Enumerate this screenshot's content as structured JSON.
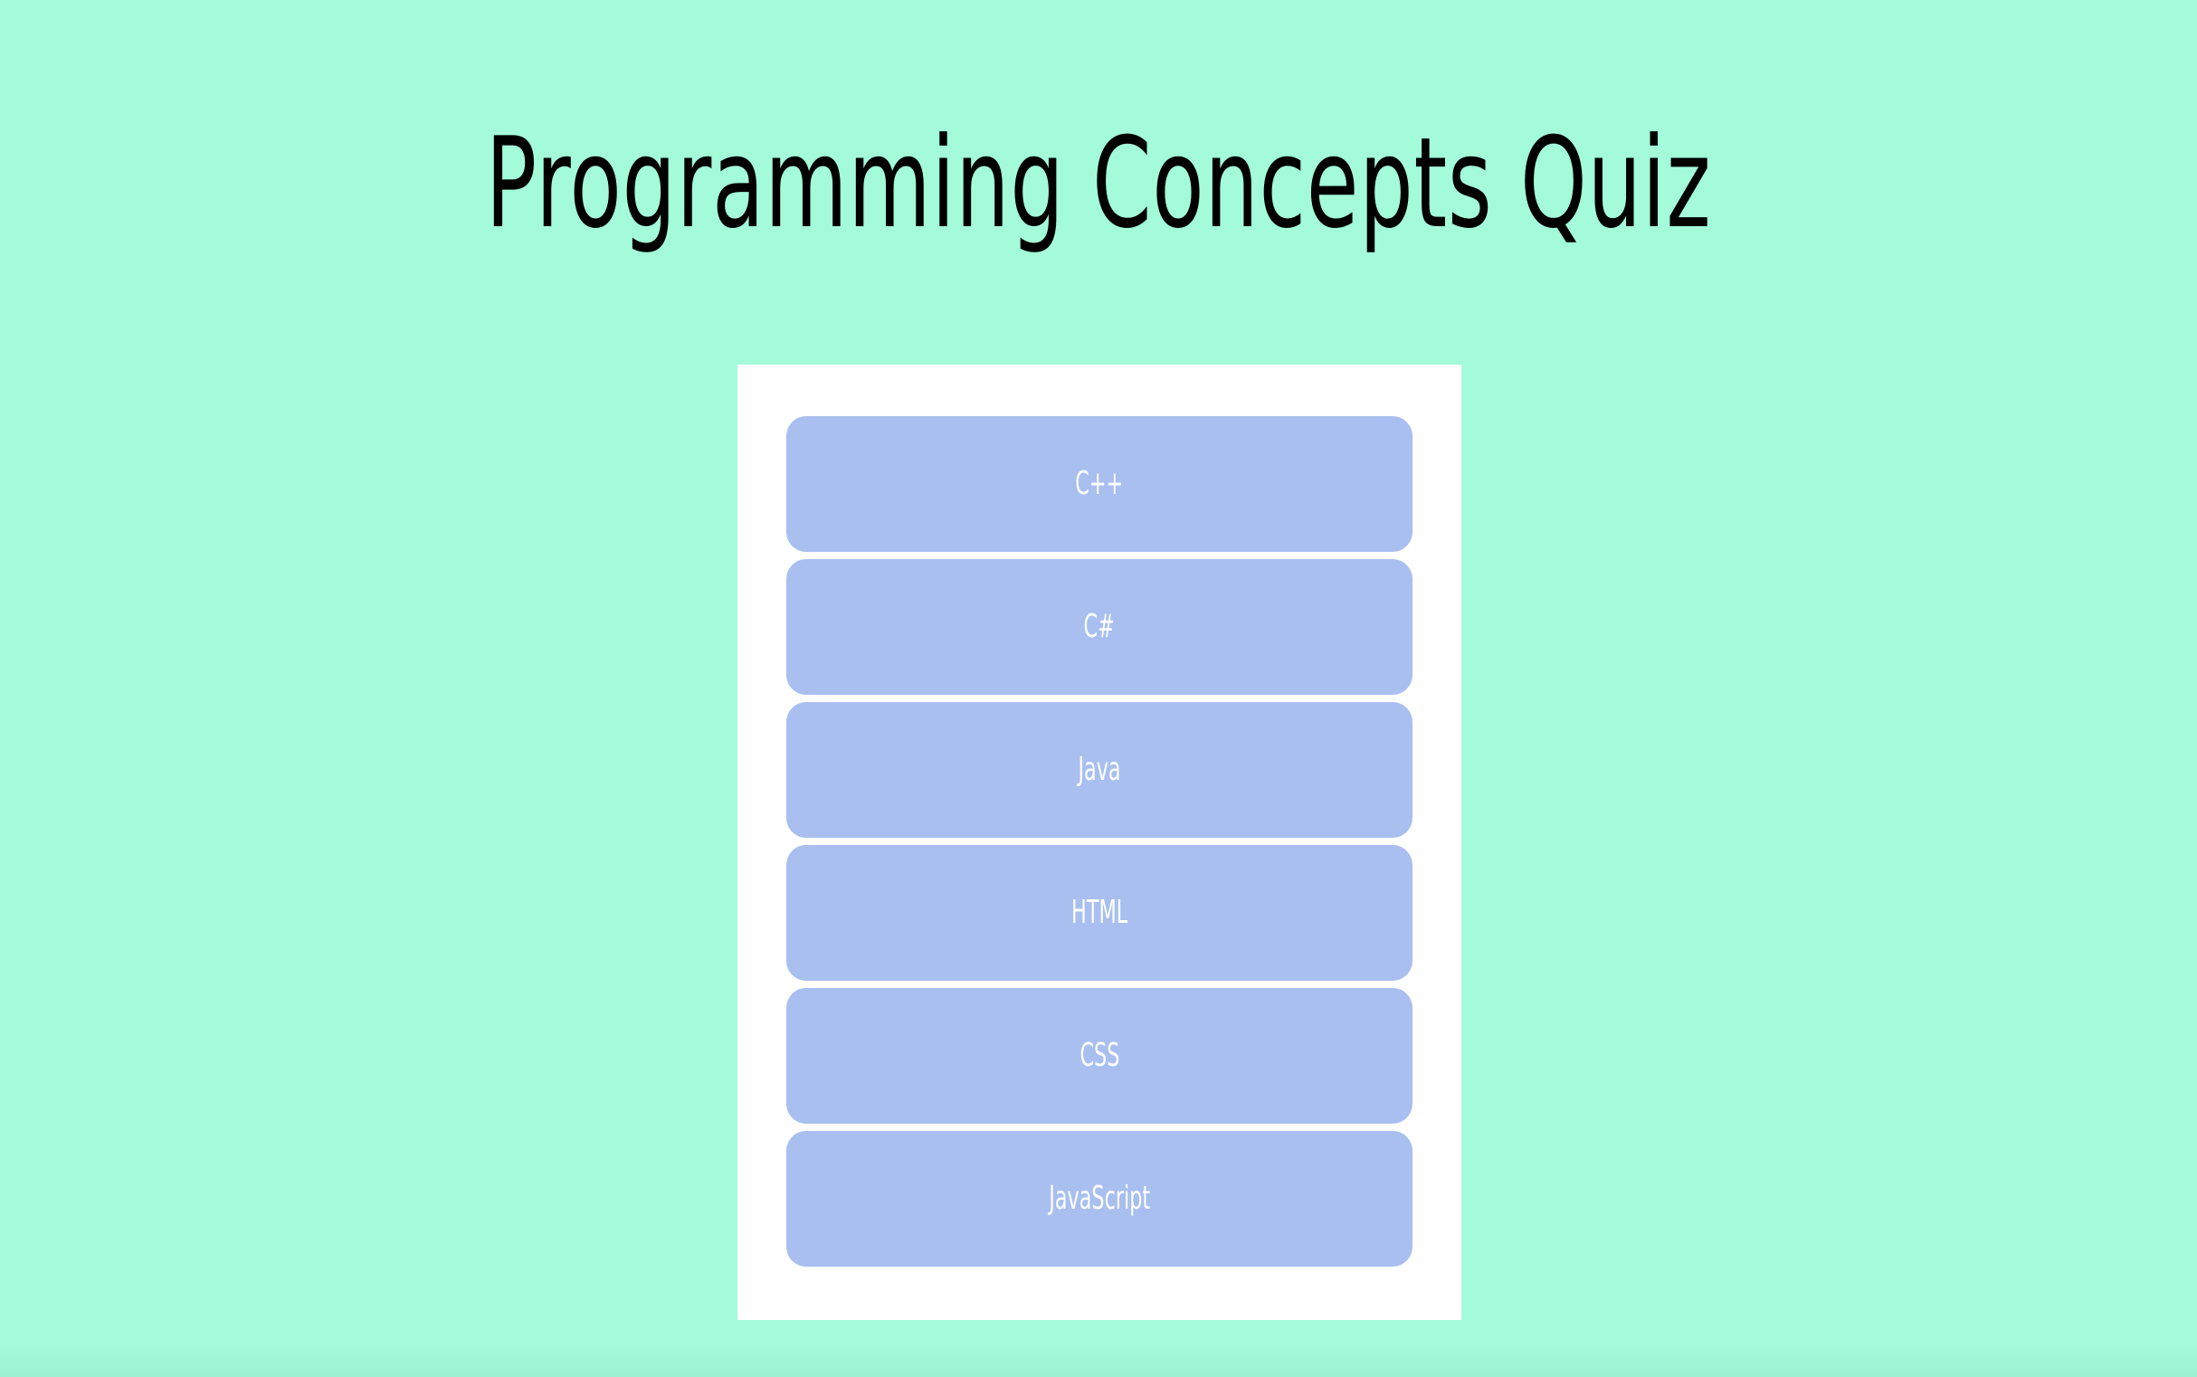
{
  "page": {
    "title": "Programming Concepts Quiz",
    "background_color": "#a3fbd9"
  },
  "quiz": {
    "card_color": "#ffffff",
    "button_color": "#a8bff0",
    "button_text_color": "#ffffff",
    "options": [
      {
        "label": "C++"
      },
      {
        "label": "C#"
      },
      {
        "label": "Java"
      },
      {
        "label": "HTML"
      },
      {
        "label": "CSS"
      },
      {
        "label": "JavaScript"
      }
    ]
  }
}
